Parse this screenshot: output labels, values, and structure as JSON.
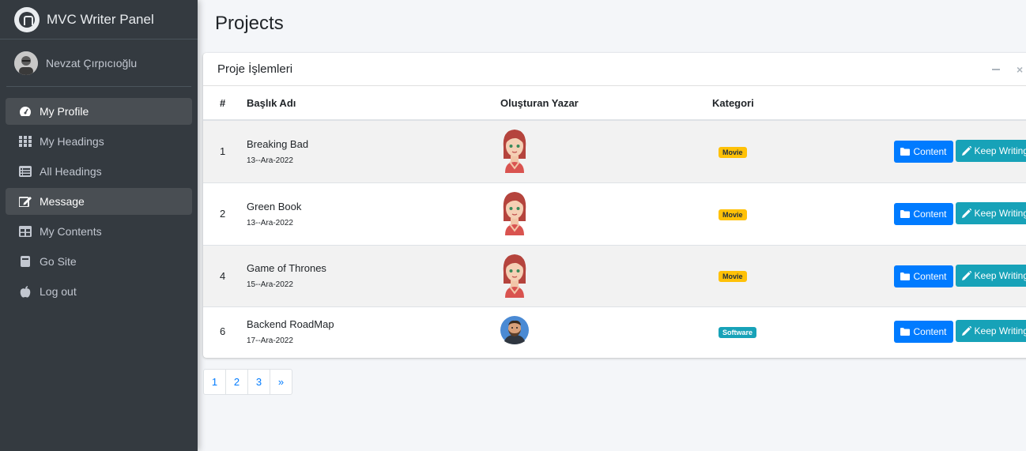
{
  "brand": {
    "title": "MVC Writer Panel"
  },
  "user": {
    "name": "Nevzat Çırpıcıoğlu"
  },
  "sidebar": {
    "items": [
      {
        "label": "My Profile",
        "icon": "tachometer-icon",
        "active": true
      },
      {
        "label": "My Headings",
        "icon": "grid-icon",
        "active": false
      },
      {
        "label": "All Headings",
        "icon": "list-icon",
        "active": false
      },
      {
        "label": "Message",
        "icon": "edit-icon",
        "active": true
      },
      {
        "label": "My Contents",
        "icon": "table-icon",
        "active": false
      },
      {
        "label": "Go Site",
        "icon": "book-icon",
        "active": false
      },
      {
        "label": "Log out",
        "icon": "apple-icon",
        "active": false
      }
    ]
  },
  "page": {
    "title": "Projects"
  },
  "card": {
    "title": "Proje İşlemleri",
    "minimize": "−",
    "close": "×"
  },
  "table": {
    "headers": [
      "#",
      "Başlık Adı",
      "Oluşturan Yazar",
      "Kategori",
      ""
    ],
    "rows": [
      {
        "num": "1",
        "title": "Breaking Bad",
        "date": "13--Ara-2022",
        "avatar": "female",
        "category": "Movie",
        "badge": "warning"
      },
      {
        "num": "2",
        "title": "Green Book",
        "date": "13--Ara-2022",
        "avatar": "female",
        "category": "Movie",
        "badge": "warning"
      },
      {
        "num": "4",
        "title": "Game of Thrones",
        "date": "15--Ara-2022",
        "avatar": "female",
        "category": "Movie",
        "badge": "warning"
      },
      {
        "num": "6",
        "title": "Backend RoadMap",
        "date": "17--Ara-2022",
        "avatar": "male",
        "category": "Software",
        "badge": "info"
      }
    ],
    "actions": {
      "content": "Content",
      "keep_writing": "Keep Writing"
    }
  },
  "pagination": {
    "pages": [
      "1",
      "2",
      "3",
      "»"
    ]
  },
  "colors": {
    "sidebar": "#343a40",
    "primary": "#007bff",
    "info": "#17a2b8",
    "warning": "#ffc107"
  }
}
